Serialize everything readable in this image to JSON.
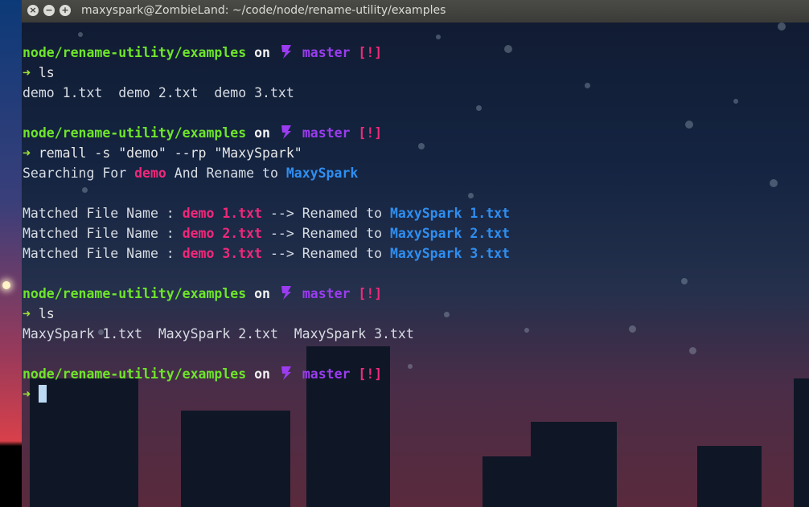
{
  "window": {
    "title": "maxyspark@ZombieLand: ~/code/node/rename-utility/examples",
    "controls": {
      "close": "×",
      "minimize": "−",
      "maximize": "+"
    }
  },
  "prompt": {
    "dir": "node/rename-utility/examples",
    "on": "on",
    "branch": "master",
    "status": "[!]",
    "arrow": "➜"
  },
  "commands": {
    "c1": "ls",
    "c2": "remall -s \"demo\" --rp \"MaxySpark\"",
    "c3": "ls"
  },
  "output": {
    "ls1": "demo 1.txt  demo 2.txt  demo 3.txt",
    "search": {
      "prefix": "Searching For ",
      "term": "demo",
      "mid": " And Rename to ",
      "repl": "MaxySpark"
    },
    "matched": [
      {
        "label": "Matched File Name : ",
        "old": "demo 1.txt",
        "arrow": " --> Renamed to ",
        "new": "MaxySpark 1.txt"
      },
      {
        "label": "Matched File Name : ",
        "old": "demo 2.txt",
        "arrow": " --> Renamed to ",
        "new": "MaxySpark 2.txt"
      },
      {
        "label": "Matched File Name : ",
        "old": "demo 3.txt",
        "arrow": " --> Renamed to ",
        "new": "MaxySpark 3.txt"
      }
    ],
    "ls2": "MaxySpark 1.txt  MaxySpark 2.txt  MaxySpark 3.txt"
  },
  "colors": {
    "dir": "#6ee52a",
    "branch": "#9b3cf0",
    "status": "#f02a7a",
    "highlight_pink": "#f0287a",
    "highlight_blue": "#2f8ef0",
    "cursor": "#bcd9f4"
  },
  "icons": {
    "git_branch": "git-branch-icon"
  }
}
